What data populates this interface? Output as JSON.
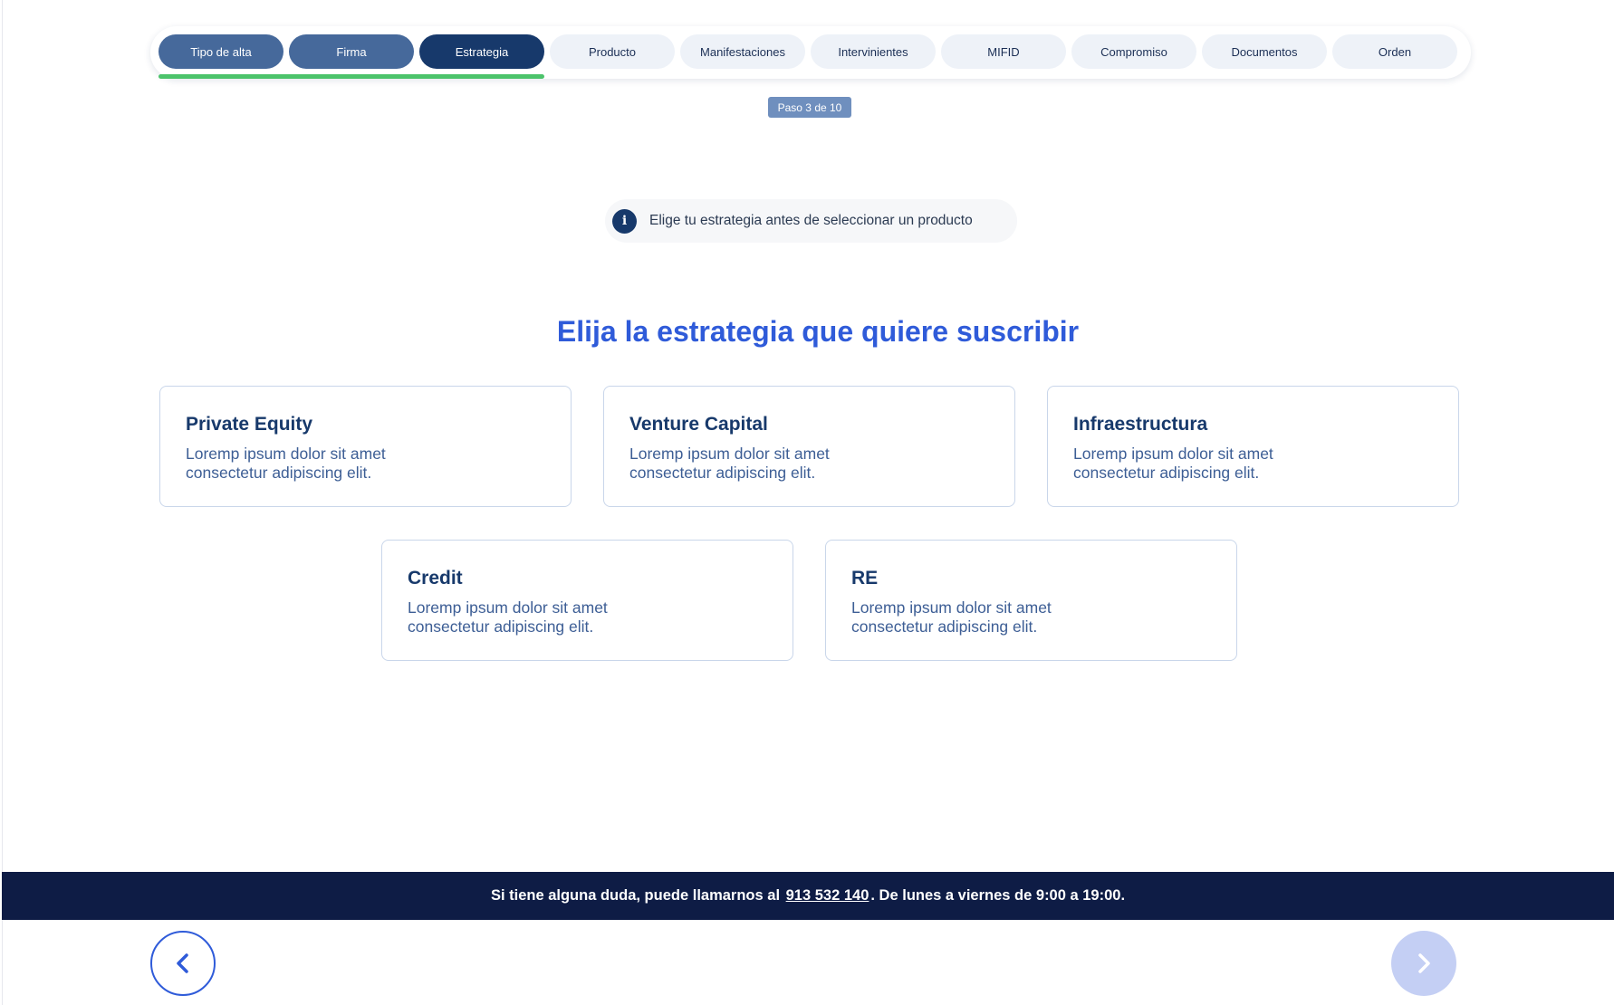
{
  "stepper": {
    "steps": [
      {
        "label": "Tipo de alta",
        "state": "done"
      },
      {
        "label": "Firma",
        "state": "done"
      },
      {
        "label": "Estrategia",
        "state": "current"
      },
      {
        "label": "Producto",
        "state": "pending"
      },
      {
        "label": "Manifestaciones",
        "state": "pending"
      },
      {
        "label": "Intervinientes",
        "state": "pending"
      },
      {
        "label": "MIFID",
        "state": "pending"
      },
      {
        "label": "Compromiso",
        "state": "pending"
      },
      {
        "label": "Documentos",
        "state": "pending"
      },
      {
        "label": "Orden",
        "state": "pending"
      }
    ],
    "step_indicator": "Paso 3 de 10",
    "progress_fraction": 0.3,
    "progress_color": "#4cc36b"
  },
  "info": {
    "icon": "info-icon",
    "text": "Elige tu estrategia antes de seleccionar un producto"
  },
  "headline": "Elija la estrategia que quiere suscribir",
  "strategies": [
    {
      "title": "Private Equity",
      "description": "Loremp ipsum dolor sit amet consectetur adipiscing elit."
    },
    {
      "title": "Venture Capital",
      "description": "Loremp ipsum dolor sit amet consectetur adipiscing elit."
    },
    {
      "title": "Infraestructura",
      "description": "Loremp ipsum dolor sit amet consectetur adipiscing elit."
    },
    {
      "title": "Credit",
      "description": "Loremp ipsum dolor sit amet consectetur adipiscing elit."
    },
    {
      "title": "RE",
      "description": "Loremp ipsum dolor sit amet consectetur adipiscing elit."
    }
  ],
  "footer": {
    "prefix": "Si tiene alguna duda, puede llamarnos al",
    "phone": "913 532 140",
    "suffix": ". De lunes a viernes de 9:00 a 19:00."
  },
  "nav": {
    "back_icon": "chevron-left-icon",
    "next_icon": "chevron-right-icon"
  },
  "colors": {
    "accent": "#2f5bd9",
    "navy": "#17396b",
    "footer_bg": "#0e1c45"
  }
}
